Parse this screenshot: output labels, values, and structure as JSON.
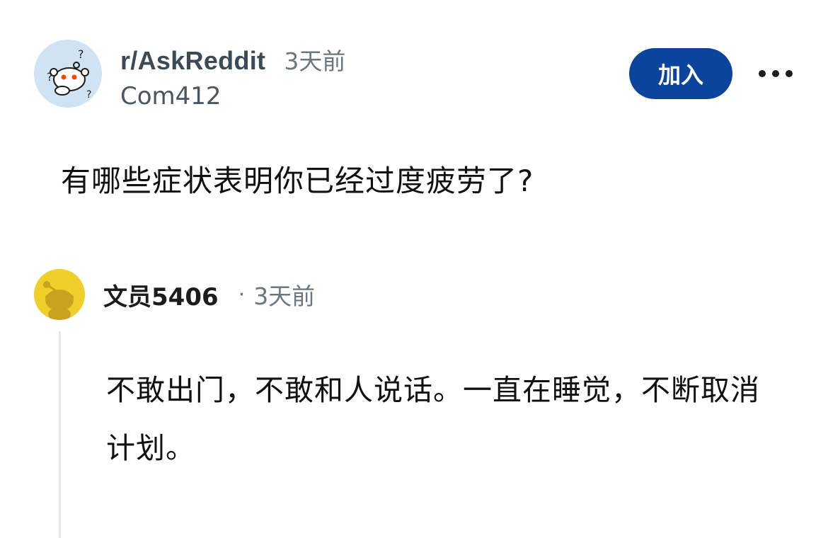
{
  "post": {
    "subreddit": "r/AskReddit",
    "time": "3天前",
    "author": "Com412",
    "join_label": "加入",
    "title": "有哪些症状表明你已经过度疲劳了?"
  },
  "comment": {
    "author": "文员5406",
    "separator": "·",
    "time": "3天前",
    "body": "不敢出门，不敢和人说话。一直在睡觉，不断取消计划。"
  },
  "colors": {
    "join_button": "#0b449d",
    "comment_avatar": "#f1cf2b",
    "subreddit_avatar": "#cfe3f3"
  }
}
